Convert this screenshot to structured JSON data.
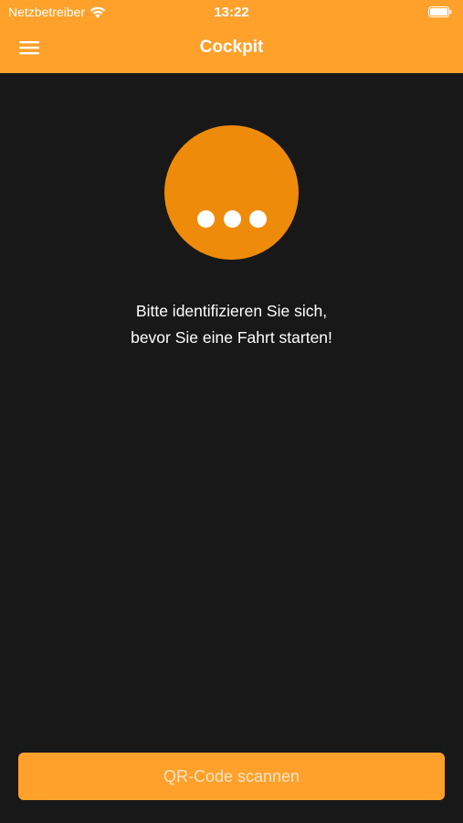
{
  "status_bar": {
    "carrier": "Netzbetreiber",
    "time": "13:22",
    "wifi_icon": "wifi-icon",
    "battery_icon": "battery-icon"
  },
  "nav": {
    "title": "Cockpit",
    "menu_icon": "hamburger-menu-icon"
  },
  "status": {
    "icon": "more-dots-icon",
    "message_line1": "Bitte identifizieren Sie sich,",
    "message_line2": "bevor Sie eine Fahrt starten!"
  },
  "actions": {
    "scan_label": "QR-Code scannen"
  },
  "colors": {
    "accent": "#ffa12b",
    "circle": "#ef8b0a",
    "background": "#181818",
    "button_text": "#fde3c4"
  }
}
